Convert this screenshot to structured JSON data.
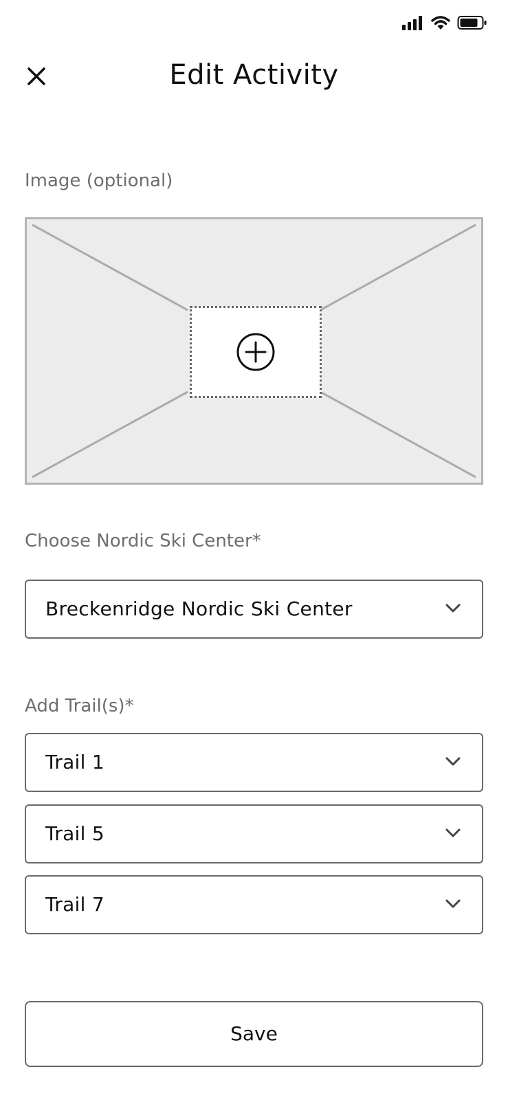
{
  "status_bar": {
    "icons": [
      "cellular-signal-icon",
      "wifi-icon",
      "battery-icon"
    ]
  },
  "header": {
    "close_icon": "close-icon",
    "title": "Edit Activity"
  },
  "image_section": {
    "label": "Image (optional)",
    "add_icon": "plus-circle-icon"
  },
  "center_section": {
    "label": "Choose Nordic Ski Center*",
    "selected": "Breckenridge Nordic Ski Center"
  },
  "trails_section": {
    "label": "Add Trail(s)*",
    "trails": [
      {
        "value": "Trail 1"
      },
      {
        "value": "Trail 5"
      },
      {
        "value": "Trail 7"
      }
    ]
  },
  "footer": {
    "save_label": "Save"
  },
  "colors": {
    "text": "#111111",
    "label": "#6e6e6e",
    "border": "#6a6a6a",
    "placeholder_bg": "#ececec",
    "placeholder_border": "#b3b3b3"
  }
}
